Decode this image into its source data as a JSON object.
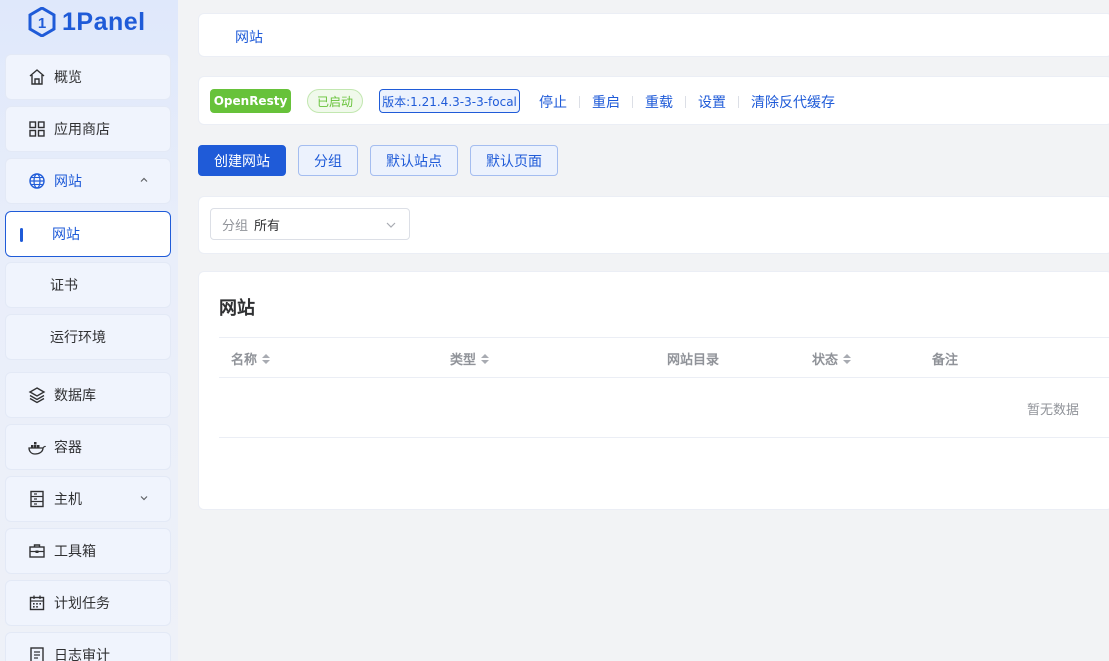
{
  "logo": {
    "text": "1Panel",
    "color": "#1f5bd8"
  },
  "sidebar": {
    "items": [
      {
        "label": "概览",
        "icon": "home-icon"
      },
      {
        "label": "应用商店",
        "icon": "grid-icon"
      },
      {
        "label": "网站",
        "icon": "globe-icon",
        "expanded": true
      },
      {
        "label": "网站",
        "sub": true,
        "active": true
      },
      {
        "label": "证书",
        "sub": true
      },
      {
        "label": "运行环境",
        "sub": true
      },
      {
        "label": "数据库",
        "icon": "layers-icon"
      },
      {
        "label": "容器",
        "icon": "docker-icon"
      },
      {
        "label": "主机",
        "icon": "server-icon",
        "expanded": false
      },
      {
        "label": "工具箱",
        "icon": "toolbox-icon"
      },
      {
        "label": "计划任务",
        "icon": "calendar-icon"
      },
      {
        "label": "日志审计",
        "icon": "log-icon"
      }
    ]
  },
  "breadcrumb": {
    "current": "网站"
  },
  "status_bar": {
    "app_tag": "OpenResty",
    "status_tag": "已启动",
    "version_tag": "版本:1.21.4.3-3-3-focal",
    "ops": [
      "停止",
      "重启",
      "重载",
      "设置",
      "清除反代缓存"
    ]
  },
  "actions": {
    "create": "创建网站",
    "group": "分组",
    "default_site": "默认站点",
    "default_page": "默认页面"
  },
  "filter": {
    "prefix": "分组",
    "value": "所有"
  },
  "table": {
    "title": "网站",
    "columns": [
      {
        "label": "名称",
        "sortable": true
      },
      {
        "label": "类型",
        "sortable": true
      },
      {
        "label": "网站目录",
        "sortable": false
      },
      {
        "label": "状态",
        "sortable": true
      },
      {
        "label": "备注",
        "sortable": false
      }
    ],
    "empty_text": "暂无数据"
  },
  "colors": {
    "primary": "#1f5bd8",
    "success": "#67c23a"
  }
}
